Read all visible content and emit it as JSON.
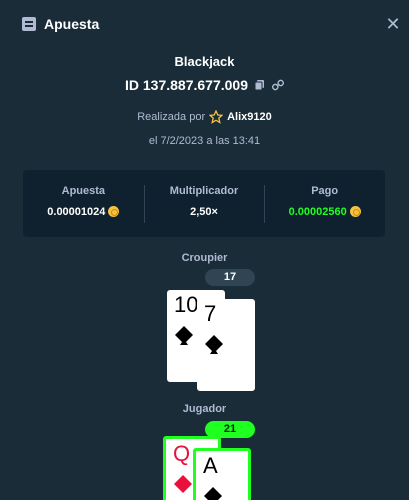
{
  "header": {
    "title": "Apuesta",
    "icon": "receipt-icon",
    "close_icon": "close-icon"
  },
  "bet": {
    "game": "Blackjack",
    "id": "ID 137.887.677.009",
    "placed_by_label": "Realizada por",
    "username": "Alix9120",
    "date": "el 7/2/2023 a las 13:41"
  },
  "stats": {
    "bet_label": "Apuesta",
    "bet_value": "0.00001024",
    "multiplier_label": "Multiplicador",
    "multiplier_value": "2,50×",
    "payout_label": "Pago",
    "payout_value": "0.00002560"
  },
  "dealer": {
    "label": "Croupier",
    "score": "17",
    "cards": [
      {
        "rank": "10",
        "suit": "spades"
      },
      {
        "rank": "7",
        "suit": "spades"
      }
    ]
  },
  "player": {
    "label": "Jugador",
    "score": "21",
    "cards": [
      {
        "rank": "Q",
        "suit": "diamonds"
      },
      {
        "rank": "A",
        "suit": "spades"
      }
    ]
  },
  "colors": {
    "background": "#1a2c38",
    "panel": "#0f212e",
    "muted_text": "#b1bad3",
    "win_green": "#1fff20",
    "dealer_badge": "#2f4553",
    "diamond_red": "#e9113c"
  }
}
